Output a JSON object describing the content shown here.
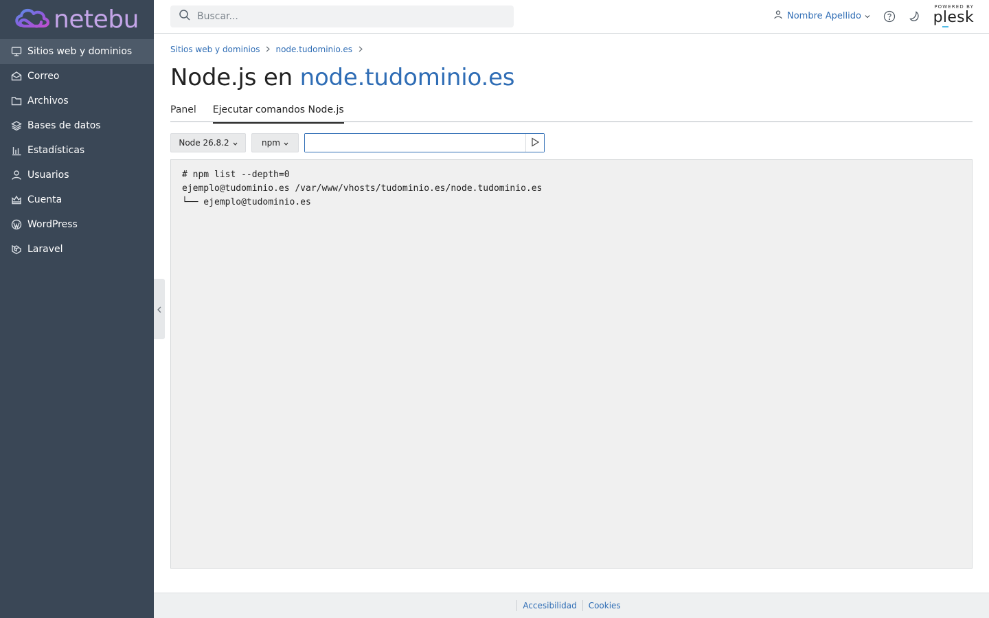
{
  "brand": {
    "name": "netebu",
    "logo_icon": "cloud-logo-icon"
  },
  "sidebar": {
    "items": [
      {
        "label": "Sitios web y dominios",
        "icon": "monitor-icon",
        "active": true
      },
      {
        "label": "Correo",
        "icon": "mail-icon",
        "active": false
      },
      {
        "label": "Archivos",
        "icon": "folder-icon",
        "active": false
      },
      {
        "label": "Bases de datos",
        "icon": "layers-icon",
        "active": false
      },
      {
        "label": "Estadísticas",
        "icon": "bar-chart-icon",
        "active": false
      },
      {
        "label": "Usuarios",
        "icon": "user-icon",
        "active": false
      },
      {
        "label": "Cuenta",
        "icon": "crown-icon",
        "active": false
      },
      {
        "label": "WordPress",
        "icon": "wordpress-icon",
        "active": false
      },
      {
        "label": "Laravel",
        "icon": "laravel-icon",
        "active": false
      }
    ]
  },
  "header": {
    "search_placeholder": "Buscar...",
    "user_name": "Nombre Apellido",
    "powered_by": "POWERED BY",
    "plesk": "plesk"
  },
  "breadcrumb": [
    {
      "label": "Sitios web y dominios"
    },
    {
      "label": "node.tudominio.es"
    }
  ],
  "page": {
    "title_prefix": "Node.js en",
    "title_domain": "node.tudominio.es"
  },
  "tabs": [
    {
      "label": "Panel",
      "active": false
    },
    {
      "label": "Ejecutar comandos Node.js",
      "active": true
    }
  ],
  "controls": {
    "node_version": "Node 26.8.2",
    "package_manager": "npm",
    "command_value": ""
  },
  "console": {
    "lines": [
      "# npm list --depth=0",
      "ejemplo@tudominio.es /var/www/vhosts/tudominio.es/node.tudominio.es",
      "└── ejemplo@tudominio.es"
    ]
  },
  "footer": {
    "links": [
      "Accesibilidad",
      "Cookies"
    ]
  },
  "colors": {
    "sidebar_bg": "#3a4756",
    "sidebar_active": "#4d5a69",
    "link": "#2f6db5",
    "console_bg": "#f0f0f0"
  }
}
